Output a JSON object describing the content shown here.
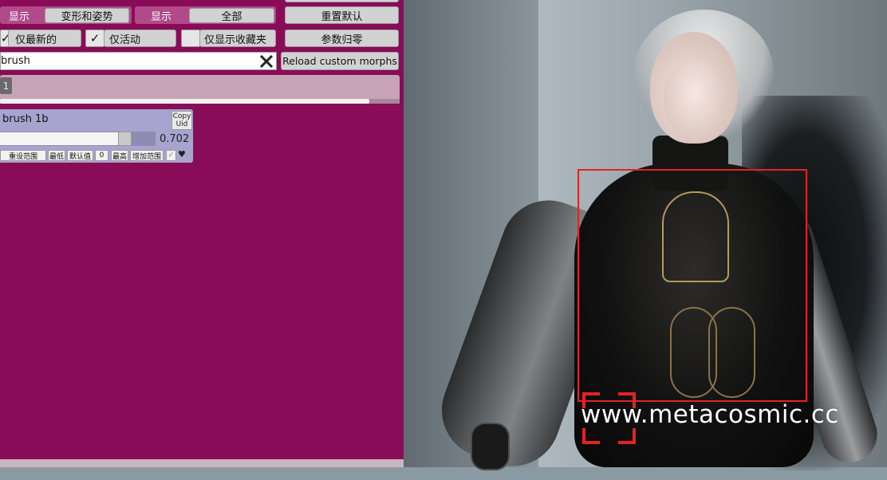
{
  "toolbar": {
    "show_label_1": "显示",
    "category_value": "变形和姿势",
    "show_label_2": "显示",
    "filter_value": "全部",
    "reset_defaults": "重置默认",
    "only_latest": "仅最新的",
    "only_active": "仅活动",
    "only_favorites": "仅显示收藏夹",
    "params_zero": "参数归零",
    "reload_morphs": "Reload custom morphs"
  },
  "search": {
    "value": "brush"
  },
  "pagination": {
    "page": "1"
  },
  "morph": {
    "name": "brush 1b",
    "copy_uid_line1": "Copy",
    "copy_uid_line2": "Uid",
    "value": "0.702",
    "value_fraction": 0.83,
    "buttons": {
      "reset_range": "重设范围",
      "min": "最低",
      "default": "默认值",
      "zero": "0",
      "max": "最高",
      "increase_range": "增加范围"
    }
  },
  "overlay": {
    "watermark": "www.metacosmic.cc",
    "box_color": "#e52222"
  },
  "colors": {
    "panel_bg": "#880c58",
    "panel_header": "#b14a8a",
    "morph_card": "#a9a3cf"
  }
}
